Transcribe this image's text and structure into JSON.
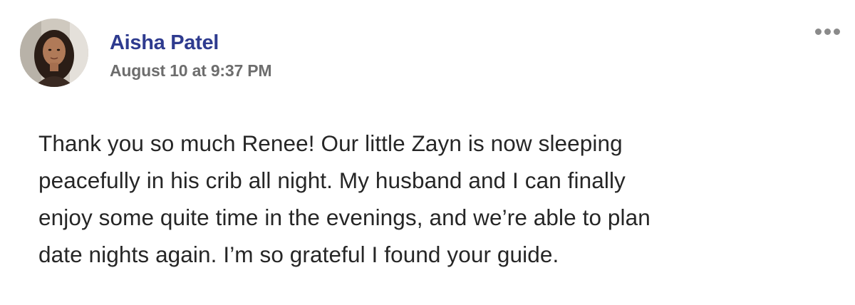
{
  "post": {
    "author": "Aisha Patel",
    "timestamp": "August 10 at 9:37 PM",
    "more_icon": "more-horizontal-icon",
    "body_lines": [
      "Thank you so much Renee! Our little Zayn is now sleeping",
      "peacefully in his crib all night. My husband and I can finally",
      "enjoy some quite time in the evenings, and we’re able to plan",
      "date nights again. I’m so grateful I found your guide."
    ]
  },
  "colors": {
    "author_name": "#2e3b8f",
    "timestamp": "#6d6d6d",
    "body_text": "#262626",
    "icon": "#8a8a8a"
  }
}
